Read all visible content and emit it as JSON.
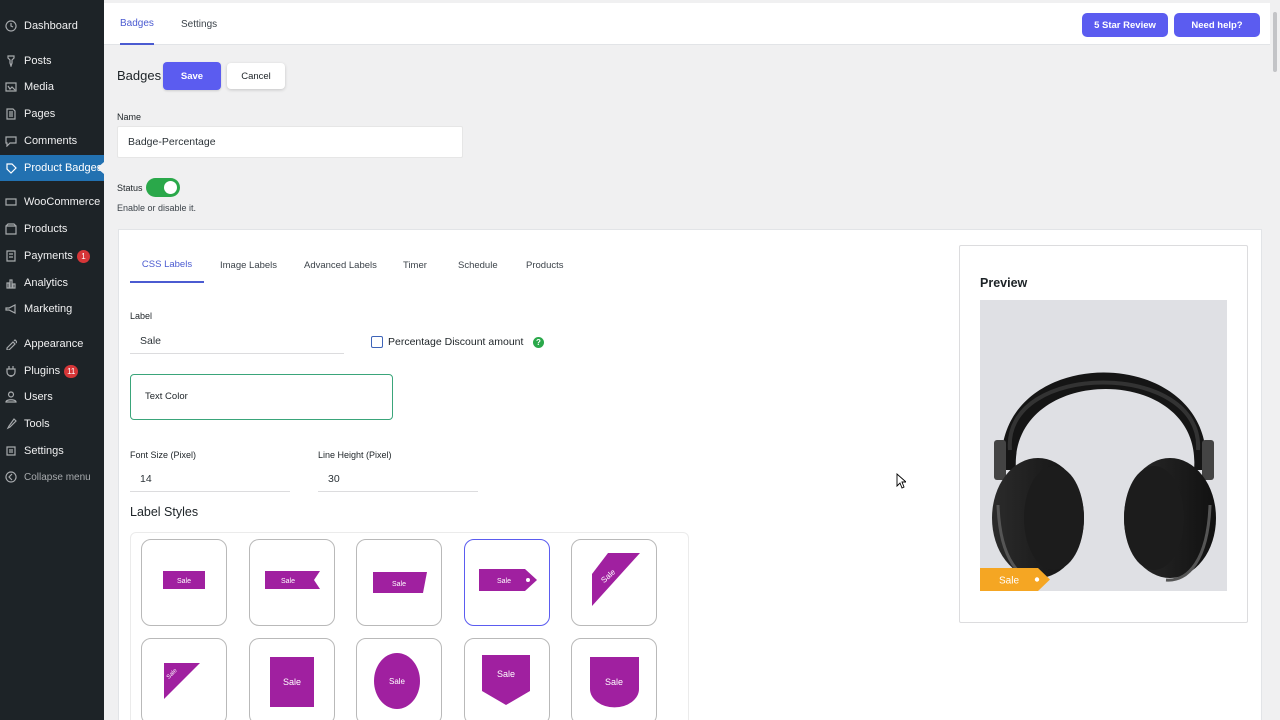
{
  "sidebar": {
    "items": [
      {
        "label": "Dashboard",
        "icon": "dashboard-icon"
      },
      {
        "label": "Posts",
        "icon": "pin-icon"
      },
      {
        "label": "Media",
        "icon": "media-icon"
      },
      {
        "label": "Pages",
        "icon": "pages-icon"
      },
      {
        "label": "Comments",
        "icon": "comments-icon"
      },
      {
        "label": "Product Badges",
        "icon": "badge-icon",
        "active": true
      },
      {
        "label": "WooCommerce",
        "icon": "woo-icon"
      },
      {
        "label": "Products",
        "icon": "products-icon"
      },
      {
        "label": "Payments",
        "icon": "payments-icon",
        "count": "1"
      },
      {
        "label": "Analytics",
        "icon": "analytics-icon"
      },
      {
        "label": "Marketing",
        "icon": "marketing-icon"
      },
      {
        "label": "Appearance",
        "icon": "appearance-icon"
      },
      {
        "label": "Plugins",
        "icon": "plugins-icon",
        "count": "11"
      },
      {
        "label": "Users",
        "icon": "users-icon"
      },
      {
        "label": "Tools",
        "icon": "tools-icon"
      },
      {
        "label": "Settings",
        "icon": "settings-icon"
      },
      {
        "label": "Collapse menu",
        "icon": "collapse-icon"
      }
    ]
  },
  "topbar": {
    "tabs": [
      "Badges",
      "Settings"
    ],
    "review_button": "5 Star Review",
    "help_button": "Need help?"
  },
  "header": {
    "title": "Badges",
    "save": "Save",
    "cancel": "Cancel"
  },
  "form": {
    "name_label": "Name",
    "name_value": "Badge-Percentage",
    "status_label": "Status",
    "status_on": true,
    "status_help": "Enable or disable it."
  },
  "panel": {
    "tabs": [
      "CSS Labels",
      "Image Labels",
      "Advanced Labels",
      "Timer",
      "Schedule",
      "Products"
    ],
    "label_label": "Label",
    "label_value": "Sale",
    "percentage_label": "Percentage Discount amount",
    "percentage_checked": false,
    "help_mark": "?",
    "text_color_label": "Text Color",
    "font_size_label": "Font Size (Pixel)",
    "font_size_value": "14",
    "line_height_label": "Line Height (Pixel)",
    "line_height_value": "30",
    "label_styles_title": "Label Styles",
    "style_text": "Sale",
    "selected_style": 4
  },
  "preview": {
    "title": "Preview",
    "badge_text": "Sale"
  },
  "colors": {
    "accent": "#5b5cf0",
    "sidebar": "#1d2327",
    "active_menu": "#2271b1",
    "badge_purple": "#a020a0",
    "preview_badge": "#f5a623",
    "toggle_on": "#2aa84a"
  }
}
